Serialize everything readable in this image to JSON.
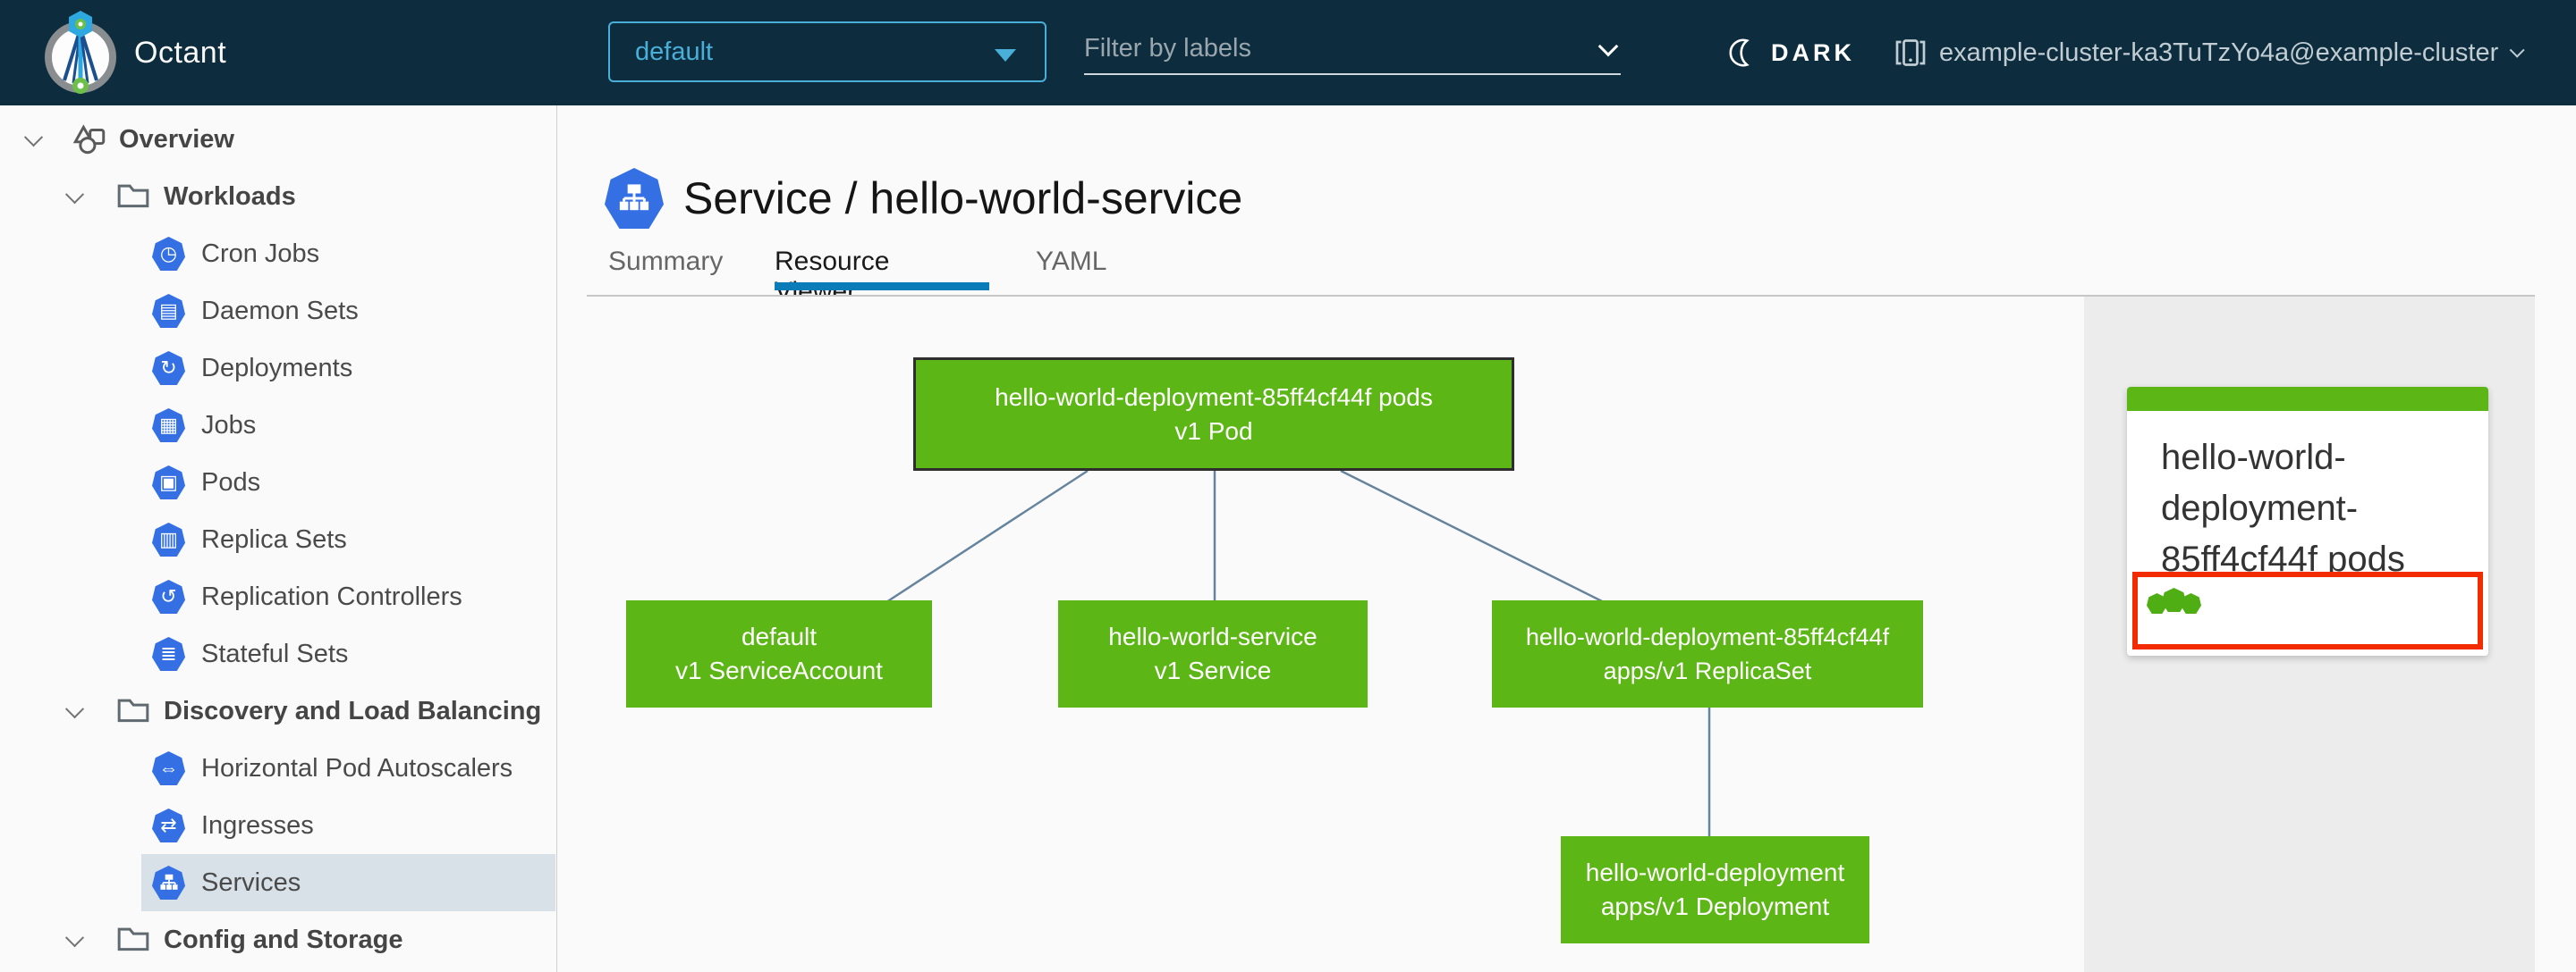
{
  "header": {
    "app_title": "Octant",
    "namespace_dropdown": {
      "value": "default"
    },
    "filter_input": {
      "placeholder": "Filter by labels"
    },
    "theme_toggle": {
      "label": "DARK"
    },
    "context_switcher": {
      "label": "example-cluster-ka3TuTzYo4a@example-cluster"
    }
  },
  "sidebar": {
    "items": [
      {
        "label": "Overview",
        "type": "root",
        "icon": "objects-icon"
      },
      {
        "label": "Workloads",
        "type": "category",
        "icon": "folder-icon"
      },
      {
        "label": "Cron Jobs",
        "type": "leaf",
        "icon": "cron-jobs-icon",
        "glyph": "◷"
      },
      {
        "label": "Daemon Sets",
        "type": "leaf",
        "icon": "daemon-sets-icon",
        "glyph": "▤"
      },
      {
        "label": "Deployments",
        "type": "leaf",
        "icon": "deployments-icon",
        "glyph": "↻"
      },
      {
        "label": "Jobs",
        "type": "leaf",
        "icon": "jobs-icon",
        "glyph": "▦"
      },
      {
        "label": "Pods",
        "type": "leaf",
        "icon": "pods-icon",
        "glyph": "▣"
      },
      {
        "label": "Replica Sets",
        "type": "leaf",
        "icon": "replica-sets-icon",
        "glyph": "▥"
      },
      {
        "label": "Replication Controllers",
        "type": "leaf",
        "icon": "replication-controllers-icon",
        "glyph": "↺"
      },
      {
        "label": "Stateful Sets",
        "type": "leaf",
        "icon": "stateful-sets-icon",
        "glyph": "≣"
      },
      {
        "label": "Discovery and Load Balancing",
        "type": "category",
        "icon": "folder-icon"
      },
      {
        "label": "Horizontal Pod Autoscalers",
        "type": "leaf",
        "icon": "hpa-icon",
        "glyph": "⇔"
      },
      {
        "label": "Ingresses",
        "type": "leaf",
        "icon": "ingresses-icon",
        "glyph": "⇄"
      },
      {
        "label": "Services",
        "type": "leaf",
        "icon": "services-icon",
        "selected": true
      },
      {
        "label": "Config and Storage",
        "type": "category",
        "icon": "folder-icon"
      }
    ]
  },
  "main": {
    "page_title": "Service / hello-world-service",
    "tabs": [
      {
        "label": "Summary",
        "active": false
      },
      {
        "label": "Resource Viewer",
        "active": true
      },
      {
        "label": "YAML",
        "active": false
      }
    ]
  },
  "graph": {
    "nodes": [
      {
        "id": "pod",
        "line1": "hello-world-deployment-85ff4cf44f pods",
        "line2": "v1 Pod",
        "selected": true
      },
      {
        "id": "serviceaccount",
        "line1": "default",
        "line2": "v1 ServiceAccount",
        "selected": false
      },
      {
        "id": "service",
        "line1": "hello-world-service",
        "line2": "v1 Service",
        "selected": false
      },
      {
        "id": "replicaset",
        "line1": "hello-world-deployment-85ff4cf44f",
        "line2": "apps/v1 ReplicaSet",
        "selected": false
      },
      {
        "id": "deployment",
        "line1": "hello-world-deployment",
        "line2": "apps/v1 Deployment",
        "selected": false
      }
    ]
  },
  "detail_panel": {
    "card": {
      "title": "hello-world-deployment-85ff4cf44f pods",
      "pod_count": 3
    }
  },
  "colors": {
    "header_bg": "#0d2d3e",
    "accent_blue": "#49afd9",
    "tab_active_blue": "#0c7cb8",
    "k8s_blue": "#3470e4",
    "node_green": "#5cb615",
    "alert_red": "#f22b00",
    "selected_row_bg": "#d8e1e7"
  }
}
